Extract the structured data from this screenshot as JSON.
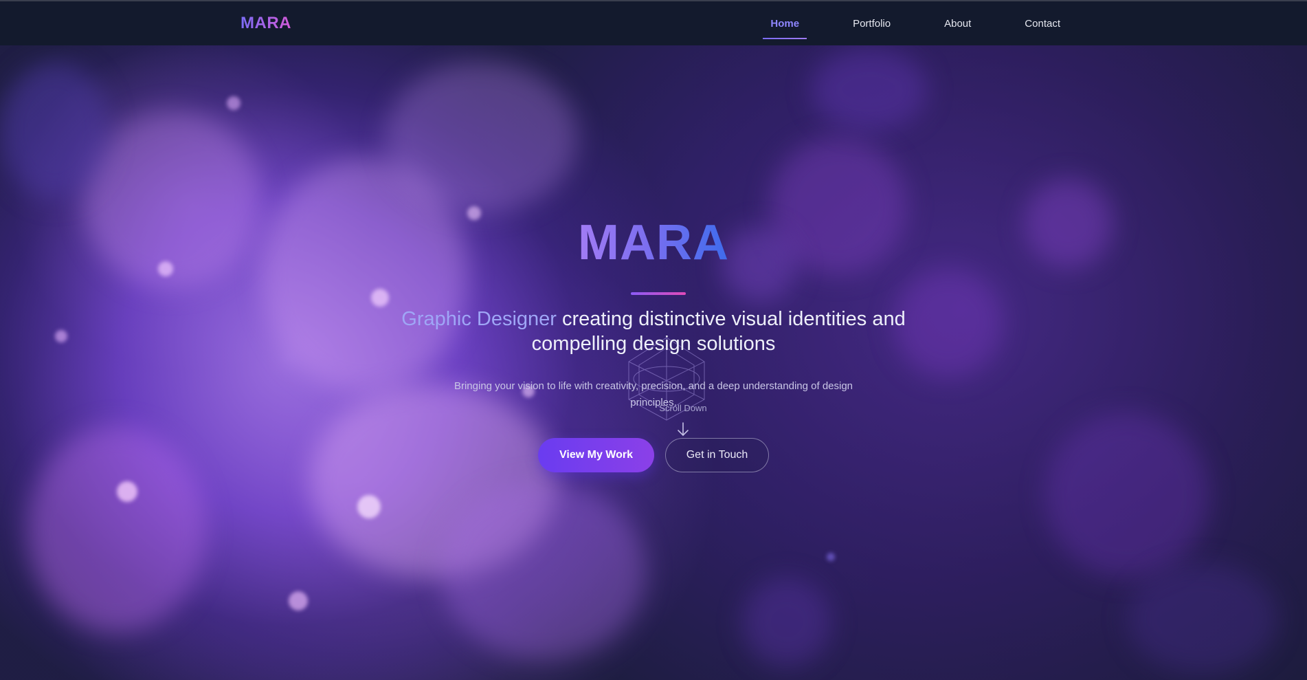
{
  "nav": {
    "logo": "MARA",
    "links": [
      {
        "label": "Home",
        "active": true
      },
      {
        "label": "Portfolio",
        "active": false
      },
      {
        "label": "About",
        "active": false
      },
      {
        "label": "Contact",
        "active": false
      }
    ]
  },
  "hero": {
    "title": "MARA",
    "tagline_accent": "Graphic Designer",
    "tagline_rest": " creating distinctive visual identities and compelling design solutions",
    "subtitle": "Bringing your vision to life with creativity, precision, and a deep understanding of design principles.",
    "scroll_hint": "Scroll Down",
    "primary_button": "View My Work",
    "secondary_button": "Get in Touch"
  },
  "colors": {
    "nav_background": "#131a2d",
    "accent_purple": "#7b6cf6",
    "accent_pink": "#e04ab8",
    "primary_button": "#6a3cf0"
  },
  "icons": {
    "scroll_arrow": "arrow-down-icon"
  }
}
